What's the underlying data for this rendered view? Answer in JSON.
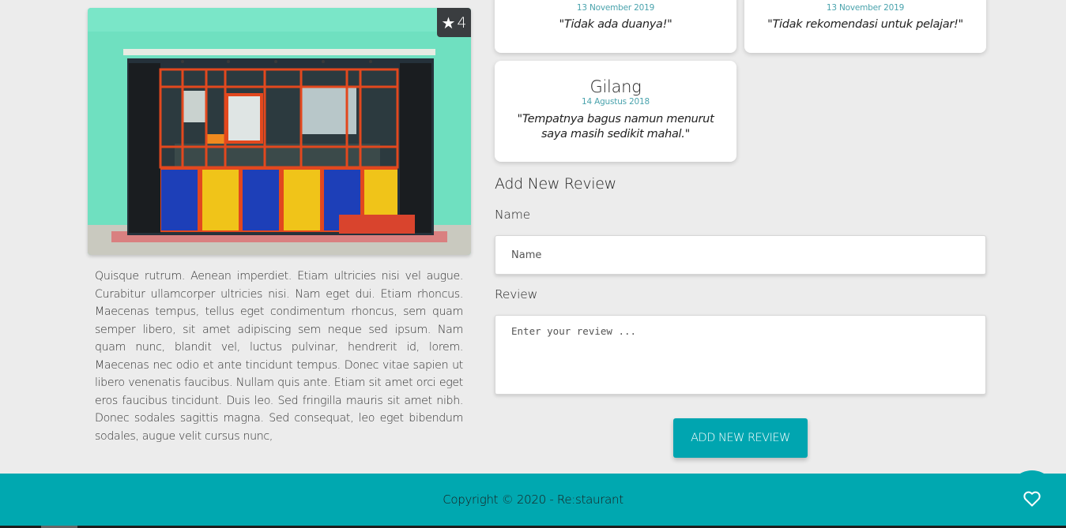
{
  "restaurant": {
    "rating": "4",
    "description": "Quisque rutrum. Aenean imperdiet. Etiam ultricies nisi vel augue. Curabitur ullamcorper ultricies nisi. Nam eget dui. Etiam rhoncus. Maecenas tempus, tellus eget condimentum rhoncus, sem quam semper libero, sit amet adipiscing sem neque sed ipsum. Nam quam nunc, blandit vel, luctus pulvinar, hendrerit id, lorem. Maecenas nec odio et ante tincidunt tempus. Donec vitae sapien ut libero venenatis faucibus. Nullam quis ante. Etiam sit amet orci eget eros faucibus tincidunt. Duis leo. Sed fringilla mauris sit amet nibh. Donec sodales sagittis magna. Sed consequat, leo eget bibendum sodales, augue velit cursus nunc,"
  },
  "reviews": [
    {
      "name": "",
      "date": "13 November 2019",
      "review": "\"Tidak ada duanya!\""
    },
    {
      "name": "",
      "date": "13 November 2019",
      "review": "\"Tidak rekomendasi untuk pelajar!\""
    },
    {
      "name": "Gilang",
      "date": "14 Agustus 2018",
      "review": "\"Tempatnya bagus namun menurut saya masih sedikit mahal.\""
    }
  ],
  "form": {
    "title": "Add New Review",
    "name_label": "Name",
    "name_placeholder": "Name",
    "review_label": "Review",
    "review_placeholder": "Enter your review ...",
    "submit_label": "ADD NEW REVIEW"
  },
  "footer": {
    "copyright": "Copyright © 2020 - Re:staurant",
    "fav_icon": "heart-outline-icon"
  },
  "colors": {
    "accent": "#00a5b0",
    "date": "#4aa3ad",
    "background": "#ececec"
  }
}
